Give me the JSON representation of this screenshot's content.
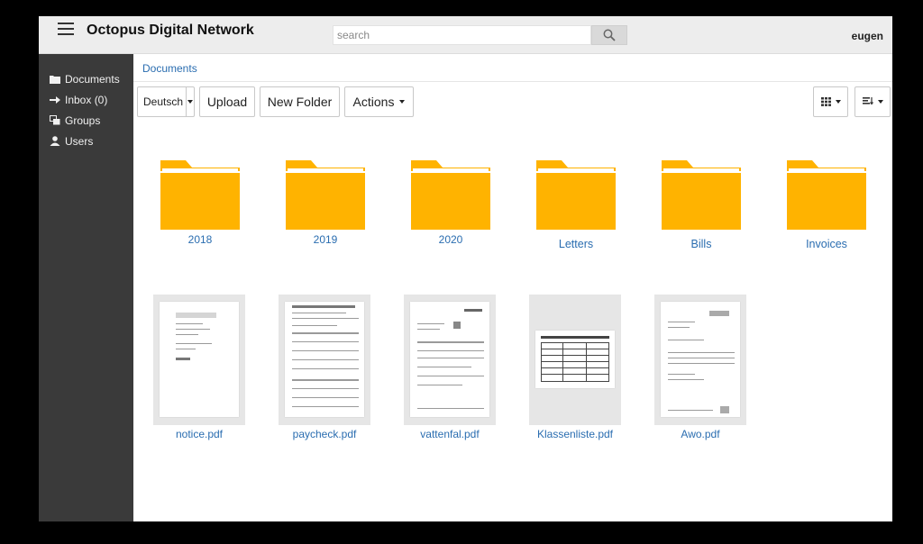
{
  "header": {
    "title": "Octopus Digital Network",
    "search_placeholder": "search",
    "username": "eugen"
  },
  "sidebar": {
    "items": [
      {
        "label": "Documents",
        "icon": "folder-icon"
      },
      {
        "label": "Inbox (0)",
        "icon": "arrow-right-icon"
      },
      {
        "label": "Groups",
        "icon": "groups-icon"
      },
      {
        "label": "Users",
        "icon": "user-icon"
      }
    ]
  },
  "breadcrumb": "Documents",
  "toolbar": {
    "language": "Deutsch",
    "upload": "Upload",
    "new_folder": "New Folder",
    "actions": "Actions"
  },
  "folders": [
    "2018",
    "2019",
    "2020",
    "Letters",
    "Bills",
    "Invoices"
  ],
  "files": [
    "notice.pdf",
    "paycheck.pdf",
    "vattenfal.pdf",
    "Klassenliste.pdf",
    "Awo.pdf"
  ],
  "colors": {
    "folder": "#ffb300",
    "link": "#2a6db0",
    "sidebar": "#3a3a3a",
    "header": "#ededed"
  }
}
